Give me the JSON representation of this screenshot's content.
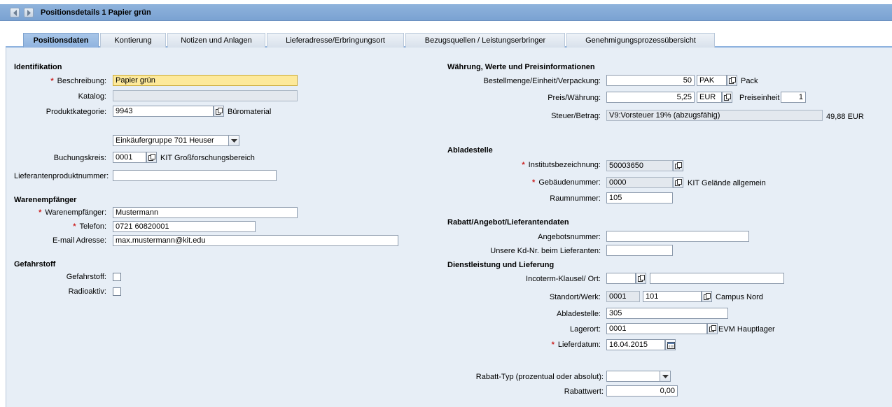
{
  "window": {
    "title": "Positionsdetails 1  Papier grün"
  },
  "tabs": [
    "Positionsdaten",
    "Kontierung",
    "Notizen und Anlagen",
    "Lieferadresse/Erbringungsort",
    "Bezugsquellen / Leistungserbringer",
    "Genehmigungsprozessübersicht"
  ],
  "ident": {
    "title": "Identifikation",
    "beschreibung_label": "Beschreibung:",
    "beschreibung_value": "Papier grün",
    "katalog_label": "Katalog:",
    "katalog_value": "",
    "produktkategorie_label": "Produktkategorie:",
    "produktkategorie_value": "9943",
    "produktkategorie_text": "Büromaterial",
    "einkaeufergruppe_value": "Einkäufergruppe 701 Heuser",
    "buchungskreis_label": "Buchungskreis:",
    "buchungskreis_value": "0001",
    "buchungskreis_text": "KIT Großforschungsbereich",
    "lieferantenproduktnummer_label": "Lieferantenproduktnummer:",
    "lieferantenproduktnummer_value": ""
  },
  "warenempfaenger": {
    "title": "Warenempfänger",
    "name_label": "Warenempfänger:",
    "name_value": "Mustermann",
    "telefon_label": "Telefon:",
    "telefon_value": "0721 60820001",
    "email_label": "E-mail Adresse:",
    "email_value": "max.mustermann@kit.edu"
  },
  "gefahrstoff": {
    "title": "Gefahrstoff",
    "gefahrstoff_label": "Gefahrstoff:",
    "radioaktiv_label": "Radioaktiv:"
  },
  "waehrung": {
    "title": "Währung, Werte und Preisinformationen",
    "menge_label": "Bestellmenge/Einheit/Verpackung:",
    "menge_value": "50",
    "einheit_value": "PAK",
    "einheit_text": "Pack",
    "preis_label": "Preis/Währung:",
    "preis_value": "5,25",
    "waehrung_value": "EUR",
    "preiseinheit_label": "Preiseinheit",
    "preiseinheit_value": "1",
    "steuer_label": "Steuer/Betrag:",
    "steuer_value": "V9:Vorsteuer 19% (abzugsfähig)",
    "steuer_betrag": "49,88 EUR"
  },
  "abladestelle": {
    "title": "Abladestelle",
    "institut_label": "Institutsbezeichnung:",
    "institut_value": "50003650",
    "gebaeude_label": "Gebäudenummer:",
    "gebaeude_value": "0000",
    "gebaeude_text": "KIT Gelände allgemein",
    "raum_label": "Raumnummer:",
    "raum_value": "105"
  },
  "rabatt_angebot": {
    "title": "Rabatt/Angebot/Lieferantendaten",
    "angebot_label": "Angebotsnummer:",
    "angebot_value": "",
    "kdnr_label": "Unsere Kd-Nr. beim Lieferanten:",
    "kdnr_value": ""
  },
  "dienstleistung": {
    "title": "Dienstleistung und Lieferung",
    "incoterm_label": "Incoterm-Klausel/ Ort:",
    "incoterm_value": "",
    "incoterm_ort": "",
    "standort_label": "Standort/Werk:",
    "standort_value": "0001",
    "werk_value": "101",
    "werk_text": "Campus Nord",
    "ablade_label": "Abladestelle:",
    "ablade_value": "305",
    "lagerort_label": "Lagerort:",
    "lagerort_value": "0001",
    "lagerort_text": "EVM Hauptlager",
    "lieferdatum_label": "Lieferdatum:",
    "lieferdatum_value": "16.04.2015",
    "rabatttyp_label": "Rabatt-Typ (prozentual oder absolut):",
    "rabatttyp_value": "",
    "rabattwert_label": "Rabattwert:",
    "rabattwert_value": "0,00"
  },
  "required_marker": "*",
  "colors": {
    "titlebar": "#8fb3dc",
    "content_bg": "#e7eef6",
    "required": "#cc2222",
    "highlight_field": "#fde99a"
  },
  "icons": [
    "nav-back-icon",
    "nav-forward-icon",
    "f4-help-icon",
    "dropdown-arrow-icon",
    "calendar-icon"
  ]
}
